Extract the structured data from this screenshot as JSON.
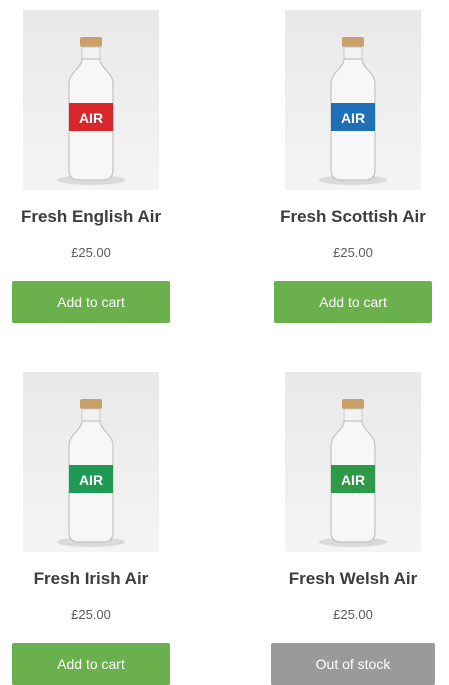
{
  "products": [
    {
      "name": "Fresh English Air",
      "price": "£25.00",
      "button_label": "Add to cart",
      "button_state": "add",
      "label_color": "#d9262c",
      "label_text": "AIR"
    },
    {
      "name": "Fresh Scottish Air",
      "price": "£25.00",
      "button_label": "Add to cart",
      "button_state": "add",
      "label_color": "#1f6fb8",
      "label_text": "AIR"
    },
    {
      "name": "Fresh Irish Air",
      "price": "£25.00",
      "button_label": "Add to cart",
      "button_state": "add",
      "label_color": "#1e9a55",
      "label_text": "AIR"
    },
    {
      "name": "Fresh Welsh Air",
      "price": "£25.00",
      "button_label": "Out of stock",
      "button_state": "out",
      "label_color": "#2e9a48",
      "label_text": "AIR"
    }
  ],
  "colors": {
    "add_button": "#6ab04c",
    "out_of_stock_button": "#9a9a9a",
    "title_text": "#3d3d3d",
    "price_text": "#5b5b5b"
  }
}
